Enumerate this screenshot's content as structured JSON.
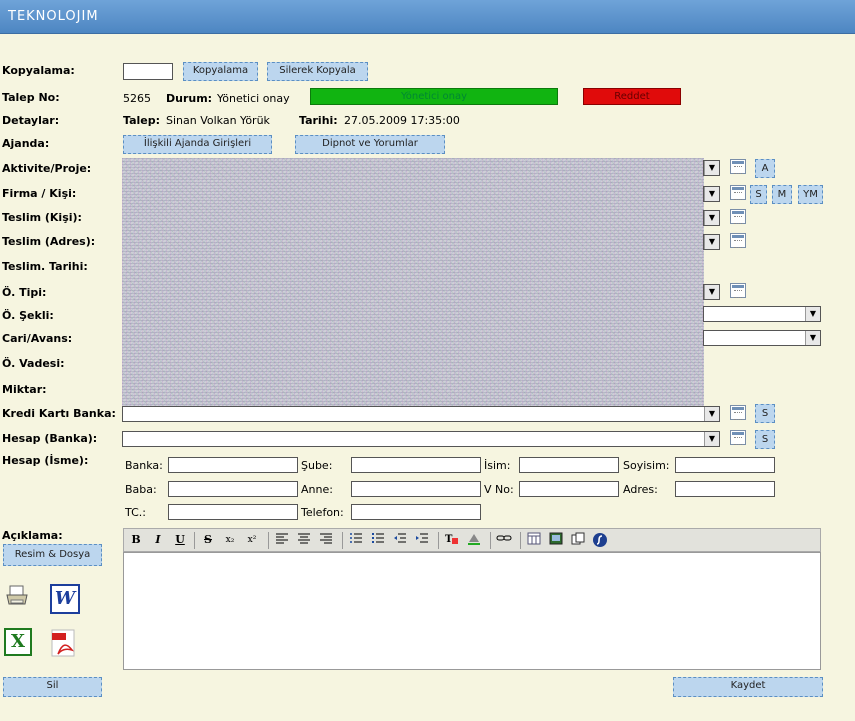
{
  "app": {
    "title": "TEKNOLOJIM"
  },
  "copy": {
    "label": "Kopyalama:",
    "input_value": "",
    "copy_btn": "Kopyalama",
    "delete_copy_btn": "Silerek Kopyala"
  },
  "request": {
    "no_label": "Talep No:",
    "no_value": "5265",
    "status_label": "Durum:",
    "status_value": "Yönetici onay",
    "status_green": "Yönetici onay",
    "status_red": "Reddet",
    "status_colors": {
      "approve": "#11b411",
      "reject": "#e00b0b"
    }
  },
  "details": {
    "label": "Detaylar:",
    "requester_label": "Talep:",
    "requester_value": "Sinan Volkan Yörük",
    "date_label": "Tarihi:",
    "date_value": "27.05.2009 17:35:00"
  },
  "agenda": {
    "label": "Ajanda:",
    "related_btn": "İlişkili Ajanda Girişleri",
    "notes_btn": "Dipnot ve Yorumlar"
  },
  "fields": {
    "activity": "Aktivite/Proje:",
    "company": "Firma / Kişi:",
    "delivery_person": "Teslim (Kişi):",
    "delivery_address": "Teslim (Adres):",
    "delivery_date": "Teslim. Tarihi:",
    "pay_type": "Ö. Tipi:",
    "pay_form": "Ö. Şekli:",
    "current": "Cari/Avans:",
    "due": "Ö. Vadesi:",
    "amount": "Miktar:",
    "credit_bank": "Kredi Kartı Banka:",
    "account_bank": "Hesap (Banka):",
    "account_name": "Hesap (İsme):"
  },
  "side_buttons": {
    "a": "A",
    "s": "S",
    "m": "M",
    "ym": "YM"
  },
  "account_name_fields": {
    "bank": "Banka:",
    "branch": "Şube:",
    "name": "İsim:",
    "surname": "Soyisim:",
    "father": "Baba:",
    "mother": "Anne:",
    "taxno": "V No:",
    "address": "Adres:",
    "tc": "TC.:",
    "phone": "Telefon:"
  },
  "description": {
    "label": "Açıklama:",
    "attach_btn": "Resim & Dosya"
  },
  "toolbar": {
    "bold": "B",
    "italic": "I",
    "underline": "U",
    "strike": "S",
    "sub": "x₂",
    "sup": "x²"
  },
  "actions": {
    "delete": "Sil",
    "save": "Kaydet"
  },
  "icons": [
    "printer-icon",
    "word-icon",
    "excel-icon",
    "pdf-icon"
  ]
}
